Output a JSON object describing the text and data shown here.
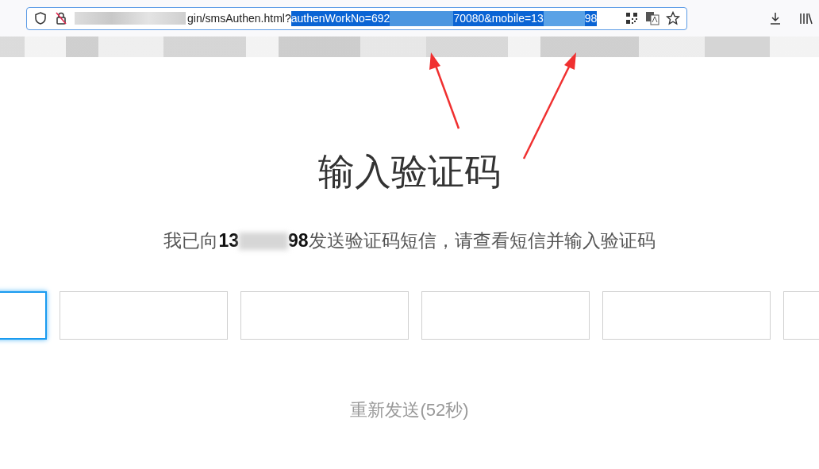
{
  "address_bar": {
    "url_start": "gin/smsAuthen.html?",
    "selected_parts": [
      "authenWorkNo=692",
      "70080&mobile=13",
      "98"
    ]
  },
  "page": {
    "title": "输入验证码",
    "message_parts": [
      "我已向**13**",
      "**98**发送验证码短信，请查看短信并输入验证码"
    ],
    "code_inputs": [
      {
        "focused": true
      },
      {
        "focused": false
      },
      {
        "focused": false
      },
      {
        "focused": false
      },
      {
        "focused": false
      },
      {
        "focused": false
      }
    ],
    "resend": "重新发送(52秒)"
  }
}
